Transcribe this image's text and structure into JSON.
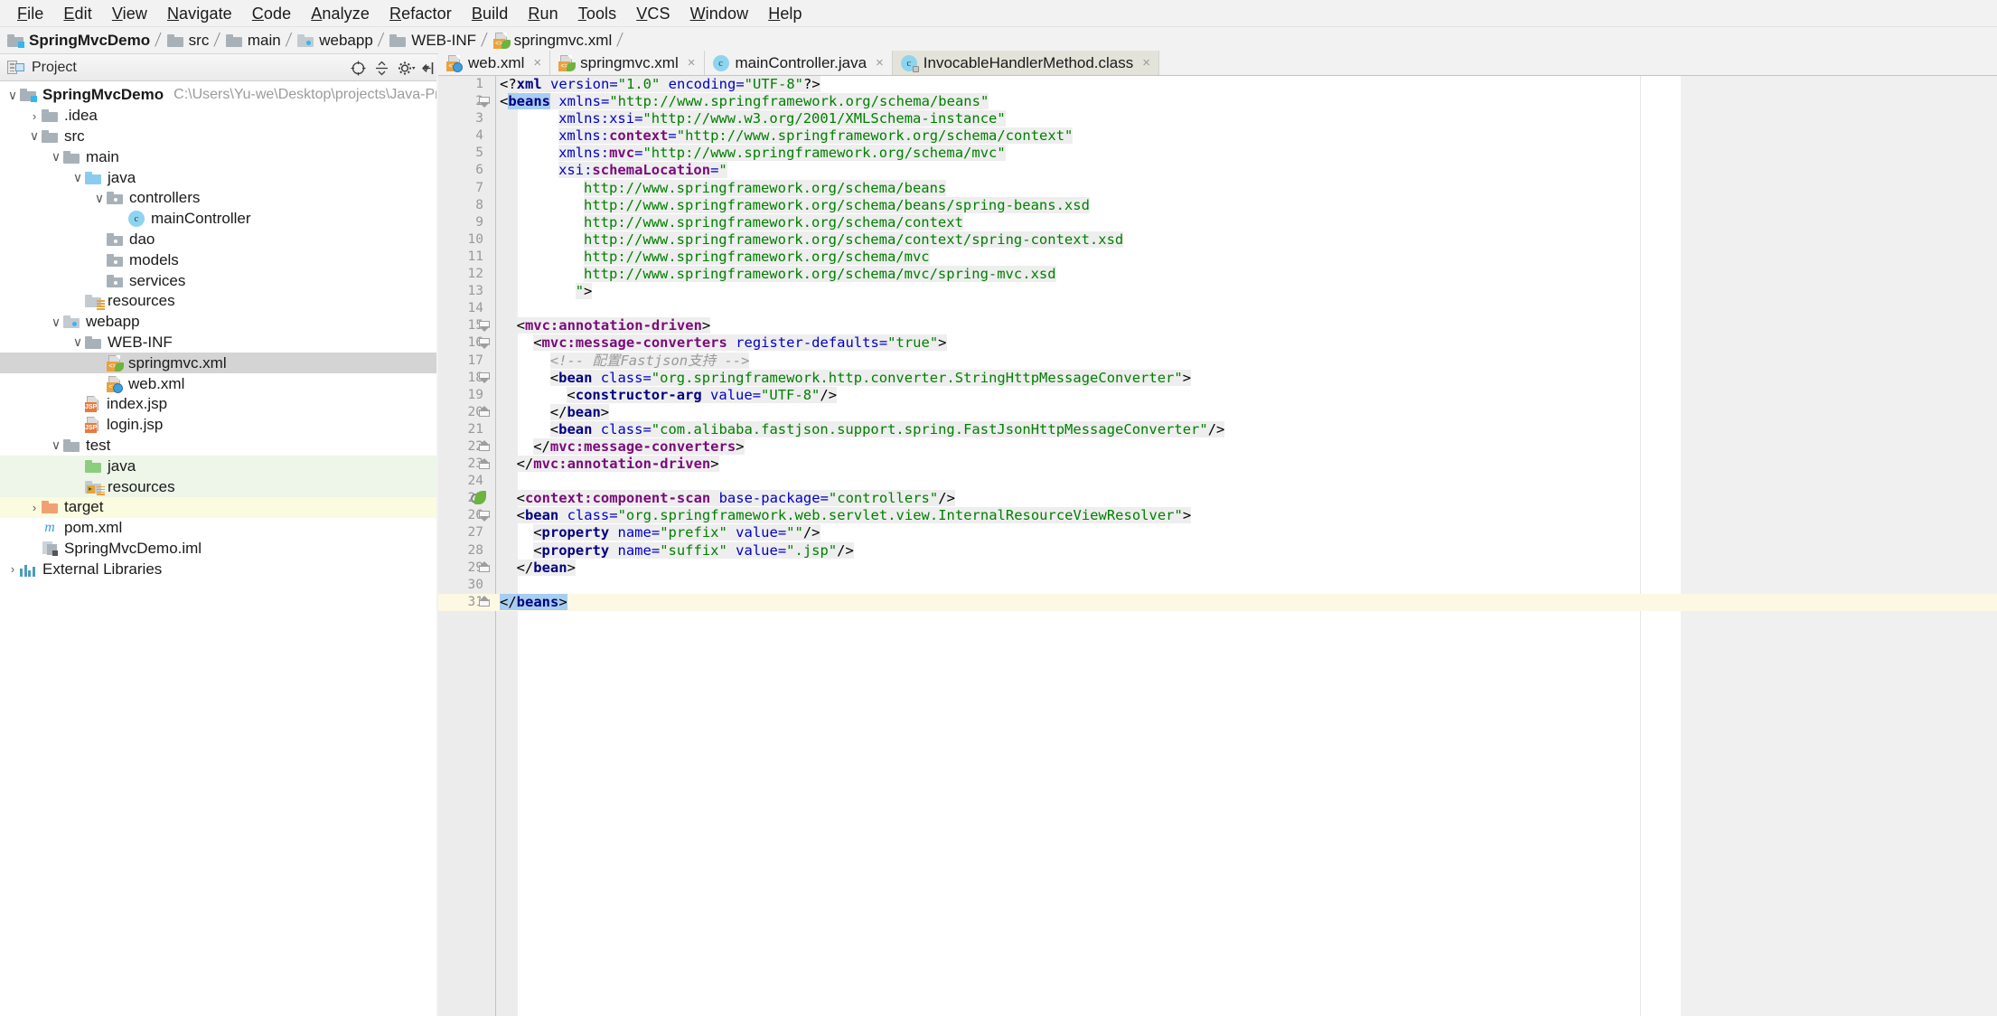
{
  "menu": {
    "items": [
      "File",
      "Edit",
      "View",
      "Navigate",
      "Code",
      "Analyze",
      "Refactor",
      "Build",
      "Run",
      "Tools",
      "VCS",
      "Window",
      "Help"
    ]
  },
  "breadcrumb": {
    "items": [
      {
        "label": "SpringMvcDemo",
        "icon": "folder-module-icon"
      },
      {
        "label": "src",
        "icon": "folder-icon"
      },
      {
        "label": "main",
        "icon": "folder-icon"
      },
      {
        "label": "webapp",
        "icon": "folder-web-icon"
      },
      {
        "label": "WEB-INF",
        "icon": "folder-icon"
      },
      {
        "label": "springmvc.xml",
        "icon": "spring-xml-file-icon"
      }
    ]
  },
  "tool_window": {
    "title": "Project",
    "icon": "project-view-icon",
    "caret": "▾",
    "toolbar": [
      "locate-icon",
      "collapse-all-icon",
      "settings-icon",
      "hide-icon"
    ]
  },
  "tabs": [
    {
      "label": "web.xml",
      "icon": "web-xml-icon",
      "active": false,
      "close": "×"
    },
    {
      "label": "springmvc.xml",
      "icon": "spring-xml-file-icon",
      "active": false,
      "close": "×"
    },
    {
      "label": "mainController.java",
      "icon": "java-class-icon",
      "active": false,
      "close": "×"
    },
    {
      "label": "InvocableHandlerMethod.class",
      "icon": "java-class-locked-icon",
      "active": true,
      "close": "×"
    }
  ],
  "tree": [
    {
      "indent": 0,
      "arrow": "∨",
      "icon": "module-folder-icon",
      "label": "SpringMvcDemo",
      "bold": true,
      "path": "C:\\Users\\Yu-we\\Desktop\\projects\\Java-Projects\\Sprin",
      "state": "none"
    },
    {
      "indent": 1,
      "arrow": "›",
      "icon": "folder-icon",
      "label": ".idea",
      "path": "",
      "state": "none"
    },
    {
      "indent": 1,
      "arrow": "∨",
      "icon": "folder-icon",
      "label": "src",
      "path": "",
      "state": "none"
    },
    {
      "indent": 2,
      "arrow": "∨",
      "icon": "folder-icon",
      "label": "main",
      "path": "",
      "state": "none"
    },
    {
      "indent": 3,
      "arrow": "∨",
      "icon": "folder-source-icon",
      "label": "java",
      "path": "",
      "state": "none"
    },
    {
      "indent": 4,
      "arrow": "∨",
      "icon": "folder-package-icon",
      "label": "controllers",
      "path": "",
      "state": "none"
    },
    {
      "indent": 5,
      "arrow": "",
      "icon": "java-class-icon",
      "label": "mainController",
      "path": "",
      "state": "none"
    },
    {
      "indent": 4,
      "arrow": "",
      "icon": "folder-package-icon",
      "label": "dao",
      "path": "",
      "state": "none"
    },
    {
      "indent": 4,
      "arrow": "",
      "icon": "folder-package-icon",
      "label": "models",
      "path": "",
      "state": "none"
    },
    {
      "indent": 4,
      "arrow": "",
      "icon": "folder-package-icon",
      "label": "services",
      "path": "",
      "state": "none"
    },
    {
      "indent": 3,
      "arrow": "",
      "icon": "folder-resources-icon",
      "label": "resources",
      "path": "",
      "state": "none"
    },
    {
      "indent": 2,
      "arrow": "∨",
      "icon": "folder-web-icon",
      "label": "webapp",
      "path": "",
      "state": "none"
    },
    {
      "indent": 3,
      "arrow": "∨",
      "icon": "folder-icon",
      "label": "WEB-INF",
      "path": "",
      "state": "none"
    },
    {
      "indent": 4,
      "arrow": "",
      "icon": "spring-xml-file-icon",
      "label": "springmvc.xml",
      "path": "",
      "state": "selected"
    },
    {
      "indent": 4,
      "arrow": "",
      "icon": "web-xml-icon",
      "label": "web.xml",
      "path": "",
      "state": "none"
    },
    {
      "indent": 3,
      "arrow": "",
      "icon": "jsp-file-icon",
      "label": "index.jsp",
      "path": "",
      "state": "none"
    },
    {
      "indent": 3,
      "arrow": "",
      "icon": "jsp-file-icon",
      "label": "login.jsp",
      "path": "",
      "state": "none"
    },
    {
      "indent": 2,
      "arrow": "∨",
      "icon": "folder-icon",
      "label": "test",
      "path": "",
      "state": "none"
    },
    {
      "indent": 3,
      "arrow": "",
      "icon": "folder-test-source-icon",
      "label": "java",
      "path": "",
      "state": "green"
    },
    {
      "indent": 3,
      "arrow": "",
      "icon": "folder-test-resources-icon",
      "label": "resources",
      "path": "",
      "state": "green"
    },
    {
      "indent": 1,
      "arrow": "›",
      "icon": "folder-excluded-icon",
      "label": "target",
      "path": "",
      "state": "yellow"
    },
    {
      "indent": 1,
      "arrow": "",
      "icon": "maven-pom-icon",
      "label": "pom.xml",
      "path": "",
      "state": "none"
    },
    {
      "indent": 1,
      "arrow": "",
      "icon": "iml-module-icon",
      "label": "SpringMvcDemo.iml",
      "path": "",
      "state": "none"
    },
    {
      "indent": 0,
      "arrow": "›",
      "icon": "external-libraries-icon",
      "label": "External Libraries",
      "path": "",
      "state": "none"
    }
  ],
  "editor": {
    "file": "springmvc.xml",
    "current_line": 31,
    "total_lines": 31,
    "lines": [
      {
        "n": 1,
        "fold": "",
        "indent": 0,
        "marker": "",
        "tokens": [
          {
            "t": "<?",
            "c": "k-punct"
          },
          {
            "t": "xml",
            "c": "k-tag"
          },
          {
            "t": " version=",
            "c": "k-attr"
          },
          {
            "t": "\"1.0\"",
            "c": "k-val"
          },
          {
            "t": " encoding=",
            "c": "k-attr"
          },
          {
            "t": "\"UTF-8\"",
            "c": "k-val"
          },
          {
            "t": "?>",
            "c": "k-punct"
          }
        ]
      },
      {
        "n": 2,
        "fold": "tri",
        "indent": 0,
        "marker": "",
        "tokens": [
          {
            "t": "<",
            "c": "k-punct"
          },
          {
            "t": "beans",
            "c": "k-tag selhl"
          },
          {
            "t": " xmlns=",
            "c": "k-attr"
          },
          {
            "t": "\"http://www.springframework.org/schema/beans\"",
            "c": "k-val"
          }
        ]
      },
      {
        "n": 3,
        "fold": "",
        "indent": 7,
        "marker": "",
        "tokens": [
          {
            "t": "xmlns:xsi=",
            "c": "k-attr"
          },
          {
            "t": "\"http://www.w3.org/2001/XMLSchema-instance\"",
            "c": "k-val"
          }
        ]
      },
      {
        "n": 4,
        "fold": "",
        "indent": 7,
        "marker": "",
        "tokens": [
          {
            "t": "xmlns:",
            "c": "k-attr"
          },
          {
            "t": "context",
            "c": "k-tagm"
          },
          {
            "t": "=",
            "c": "k-attr"
          },
          {
            "t": "\"http://www.springframework.org/schema/context\"",
            "c": "k-val"
          }
        ]
      },
      {
        "n": 5,
        "fold": "",
        "indent": 7,
        "marker": "",
        "tokens": [
          {
            "t": "xmlns:",
            "c": "k-attr"
          },
          {
            "t": "mvc",
            "c": "k-tagm"
          },
          {
            "t": "=",
            "c": "k-attr"
          },
          {
            "t": "\"http://www.springframework.org/schema/mvc\"",
            "c": "k-val"
          }
        ]
      },
      {
        "n": 6,
        "fold": "",
        "indent": 7,
        "marker": "",
        "tokens": [
          {
            "t": "xsi:",
            "c": "k-attr"
          },
          {
            "t": "schemaLocation",
            "c": "k-tagm"
          },
          {
            "t": "=",
            "c": "k-attr"
          },
          {
            "t": "\"",
            "c": "k-val"
          }
        ]
      },
      {
        "n": 7,
        "fold": "",
        "indent": 10,
        "marker": "",
        "tokens": [
          {
            "t": "http://www.springframework.org/schema/beans",
            "c": "k-val"
          }
        ]
      },
      {
        "n": 8,
        "fold": "",
        "indent": 10,
        "marker": "",
        "tokens": [
          {
            "t": "http://www.springframework.org/schema/beans/spring-beans.xsd",
            "c": "k-val"
          }
        ]
      },
      {
        "n": 9,
        "fold": "",
        "indent": 10,
        "marker": "",
        "tokens": [
          {
            "t": "http://www.springframework.org/schema/context",
            "c": "k-val"
          }
        ]
      },
      {
        "n": 10,
        "fold": "",
        "indent": 10,
        "marker": "",
        "tokens": [
          {
            "t": "http://www.springframework.org/schema/context/spring-context.xsd",
            "c": "k-val"
          }
        ]
      },
      {
        "n": 11,
        "fold": "",
        "indent": 10,
        "marker": "",
        "tokens": [
          {
            "t": "http://www.springframework.org/schema/mvc",
            "c": "k-val"
          }
        ]
      },
      {
        "n": 12,
        "fold": "",
        "indent": 10,
        "marker": "",
        "tokens": [
          {
            "t": "http://www.springframework.org/schema/mvc/spring-mvc.xsd",
            "c": "k-val"
          }
        ]
      },
      {
        "n": 13,
        "fold": "",
        "indent": 9,
        "marker": "",
        "tokens": [
          {
            "t": "\"",
            "c": "k-val"
          },
          {
            "t": ">",
            "c": "k-punct"
          }
        ]
      },
      {
        "n": 14,
        "fold": "",
        "indent": 0,
        "marker": "",
        "tokens": []
      },
      {
        "n": 15,
        "fold": "tri",
        "indent": 2,
        "marker": "",
        "tokens": [
          {
            "t": "<",
            "c": "k-punct"
          },
          {
            "t": "mvc:annotation-driven",
            "c": "k-tagm"
          },
          {
            "t": ">",
            "c": "k-punct"
          }
        ]
      },
      {
        "n": 16,
        "fold": "tri",
        "indent": 4,
        "marker": "",
        "tokens": [
          {
            "t": "<",
            "c": "k-punct"
          },
          {
            "t": "mvc:message-converters",
            "c": "k-tagm"
          },
          {
            "t": " register-defaults=",
            "c": "k-attr"
          },
          {
            "t": "\"true\"",
            "c": "k-val"
          },
          {
            "t": ">",
            "c": "k-punct"
          }
        ]
      },
      {
        "n": 17,
        "fold": "",
        "indent": 6,
        "marker": "",
        "tokens": [
          {
            "t": "<!-- 配置Fastjson支持 -->",
            "c": "k-cmt"
          }
        ]
      },
      {
        "n": 18,
        "fold": "tri",
        "indent": 6,
        "marker": "",
        "tokens": [
          {
            "t": "<",
            "c": "k-punct"
          },
          {
            "t": "bean",
            "c": "k-tag"
          },
          {
            "t": " class=",
            "c": "k-attr"
          },
          {
            "t": "\"org.springframework.http.converter.StringHttpMessageConverter\"",
            "c": "k-val"
          },
          {
            "t": ">",
            "c": "k-punct"
          }
        ]
      },
      {
        "n": 19,
        "fold": "",
        "indent": 8,
        "marker": "",
        "tokens": [
          {
            "t": "<",
            "c": "k-punct"
          },
          {
            "t": "constructor-arg",
            "c": "k-tag"
          },
          {
            "t": " value=",
            "c": "k-attr"
          },
          {
            "t": "\"UTF-8\"",
            "c": "k-val"
          },
          {
            "t": "/>",
            "c": "k-punct"
          }
        ]
      },
      {
        "n": 20,
        "fold": "end",
        "indent": 6,
        "marker": "",
        "tokens": [
          {
            "t": "</",
            "c": "k-punct"
          },
          {
            "t": "bean",
            "c": "k-tag"
          },
          {
            "t": ">",
            "c": "k-punct"
          }
        ]
      },
      {
        "n": 21,
        "fold": "",
        "indent": 6,
        "marker": "",
        "tokens": [
          {
            "t": "<",
            "c": "k-punct"
          },
          {
            "t": "bean",
            "c": "k-tag"
          },
          {
            "t": " class=",
            "c": "k-attr"
          },
          {
            "t": "\"com.alibaba.fastjson.support.spring.FastJsonHttpMessageConverter\"",
            "c": "k-val"
          },
          {
            "t": "/>",
            "c": "k-punct"
          }
        ]
      },
      {
        "n": 22,
        "fold": "end",
        "indent": 4,
        "marker": "",
        "tokens": [
          {
            "t": "</",
            "c": "k-punct"
          },
          {
            "t": "mvc:message-converters",
            "c": "k-tagm"
          },
          {
            "t": ">",
            "c": "k-punct"
          }
        ]
      },
      {
        "n": 23,
        "fold": "end",
        "indent": 2,
        "marker": "",
        "tokens": [
          {
            "t": "</",
            "c": "k-punct"
          },
          {
            "t": "mvc:annotation-driven",
            "c": "k-tagm"
          },
          {
            "t": ">",
            "c": "k-punct"
          }
        ]
      },
      {
        "n": 24,
        "fold": "",
        "indent": 0,
        "marker": "",
        "tokens": []
      },
      {
        "n": 25,
        "fold": "",
        "indent": 2,
        "marker": "spring-bean-gutter-icon",
        "tokens": [
          {
            "t": "<",
            "c": "k-punct"
          },
          {
            "t": "context:component-scan",
            "c": "k-tagm"
          },
          {
            "t": " base-package=",
            "c": "k-attr"
          },
          {
            "t": "\"controllers\"",
            "c": "k-val"
          },
          {
            "t": "/>",
            "c": "k-punct"
          }
        ]
      },
      {
        "n": 26,
        "fold": "tri",
        "indent": 2,
        "marker": "",
        "tokens": [
          {
            "t": "<",
            "c": "k-punct"
          },
          {
            "t": "bean",
            "c": "k-tag"
          },
          {
            "t": " class=",
            "c": "k-attr"
          },
          {
            "t": "\"org.springframework.web.servlet.view.InternalResourceViewResolver\"",
            "c": "k-val"
          },
          {
            "t": ">",
            "c": "k-punct"
          }
        ]
      },
      {
        "n": 27,
        "fold": "",
        "indent": 4,
        "marker": "",
        "tokens": [
          {
            "t": "<",
            "c": "k-punct"
          },
          {
            "t": "property",
            "c": "k-tag"
          },
          {
            "t": " name=",
            "c": "k-attr"
          },
          {
            "t": "\"prefix\"",
            "c": "k-val"
          },
          {
            "t": " value=",
            "c": "k-attr"
          },
          {
            "t": "\"\"",
            "c": "k-val"
          },
          {
            "t": "/>",
            "c": "k-punct"
          }
        ]
      },
      {
        "n": 28,
        "fold": "",
        "indent": 4,
        "marker": "",
        "tokens": [
          {
            "t": "<",
            "c": "k-punct"
          },
          {
            "t": "property",
            "c": "k-tag"
          },
          {
            "t": " name=",
            "c": "k-attr"
          },
          {
            "t": "\"suffix\"",
            "c": "k-val"
          },
          {
            "t": " value=",
            "c": "k-attr"
          },
          {
            "t": "\".jsp\"",
            "c": "k-val"
          },
          {
            "t": "/>",
            "c": "k-punct"
          }
        ]
      },
      {
        "n": 29,
        "fold": "end",
        "indent": 2,
        "marker": "",
        "tokens": [
          {
            "t": "</",
            "c": "k-punct"
          },
          {
            "t": "bean",
            "c": "k-tag"
          },
          {
            "t": ">",
            "c": "k-punct"
          }
        ]
      },
      {
        "n": 30,
        "fold": "",
        "indent": 0,
        "marker": "",
        "tokens": []
      },
      {
        "n": 31,
        "fold": "end",
        "indent": 0,
        "marker": "",
        "current": true,
        "tokens": [
          {
            "t": "</",
            "c": "k-punct selhl"
          },
          {
            "t": "beans",
            "c": "k-tag selhl"
          },
          {
            "t": ">",
            "c": "k-punct selhl"
          }
        ]
      }
    ]
  },
  "colors": {
    "tag": "#000080",
    "namespaced_tag": "#7a0a7a",
    "attribute": "#0000c8",
    "value": "#008000",
    "comment": "#9a9a9a",
    "selection": "#a8cdf0",
    "current_line": "#fdf8e3",
    "tree_selection": "#d4d4d4",
    "test_source": "#edf6e8",
    "excluded": "#fbfbe0"
  }
}
